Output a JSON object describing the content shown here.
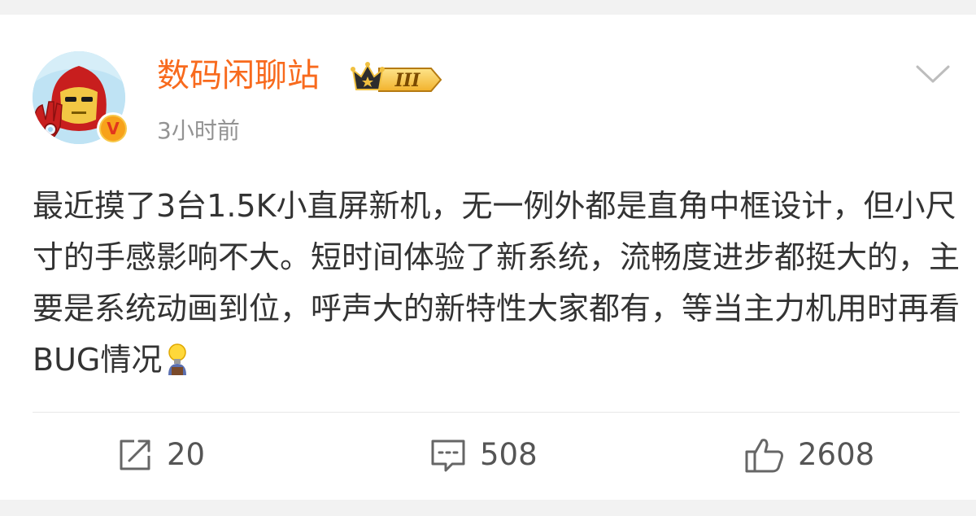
{
  "post": {
    "username": "数码闲聊站",
    "badge_level": "III",
    "time": "3小时前",
    "verified_mark": "V",
    "content": "最近摸了3台1.5K小直屏新机，无一例外都是直角中框设计，但小尺寸的手感影响不大。短时间体验了新系统，流畅度进步都挺大的，主要是系统动画到位，呼声大的新特性大家都有，等当主力机用时再看BUG情况",
    "content_emoji": "bulb-emoji"
  },
  "actions": {
    "repost_count": "20",
    "comment_count": "508",
    "like_count": "2608"
  },
  "colors": {
    "username": "#f86a1d",
    "text": "#333333",
    "muted": "#939393",
    "icon": "#666666",
    "page_bg": "#f2f2f2"
  }
}
